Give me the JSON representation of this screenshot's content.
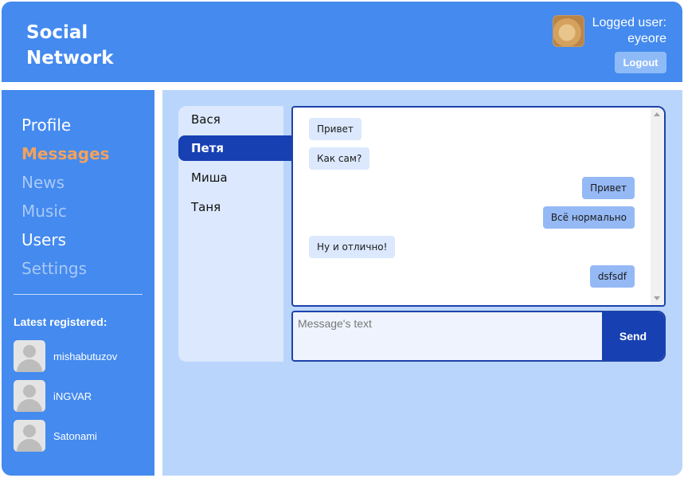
{
  "header": {
    "logo_line1": "Social",
    "logo_line2": "Network",
    "logged_label": "Logged user:",
    "username": "eyeore",
    "logout_label": "Logout"
  },
  "sidebar": {
    "nav": [
      {
        "label": "Profile",
        "state": "normal"
      },
      {
        "label": "Messages",
        "state": "active"
      },
      {
        "label": "News",
        "state": "disabled"
      },
      {
        "label": "Music",
        "state": "disabled"
      },
      {
        "label": "Users",
        "state": "normal"
      },
      {
        "label": "Settings",
        "state": "disabled"
      }
    ],
    "latest_title": "Latest registered:",
    "latest_users": [
      {
        "name": "mishabutuzov"
      },
      {
        "name": "iNGVAR"
      },
      {
        "name": "Satonami"
      }
    ]
  },
  "dialogs": [
    {
      "name": "Вася",
      "active": false
    },
    {
      "name": "Петя",
      "active": true
    },
    {
      "name": "Миша",
      "active": false
    },
    {
      "name": "Таня",
      "active": false
    }
  ],
  "messages": [
    {
      "text": "Привет",
      "direction": "in"
    },
    {
      "text": "Как сам?",
      "direction": "in"
    },
    {
      "text": "Привет",
      "direction": "out"
    },
    {
      "text": "Всё нормально",
      "direction": "out"
    },
    {
      "text": "Ну и отлично!",
      "direction": "in"
    },
    {
      "text": "dsfsdf",
      "direction": "out"
    }
  ],
  "composer": {
    "placeholder": "Message's text",
    "value": "",
    "send_label": "Send"
  },
  "colors": {
    "primary": "#448aef",
    "content_bg": "#b9d5fb",
    "active_nav": "#f5a25a",
    "dark_blue": "#1740b2"
  }
}
